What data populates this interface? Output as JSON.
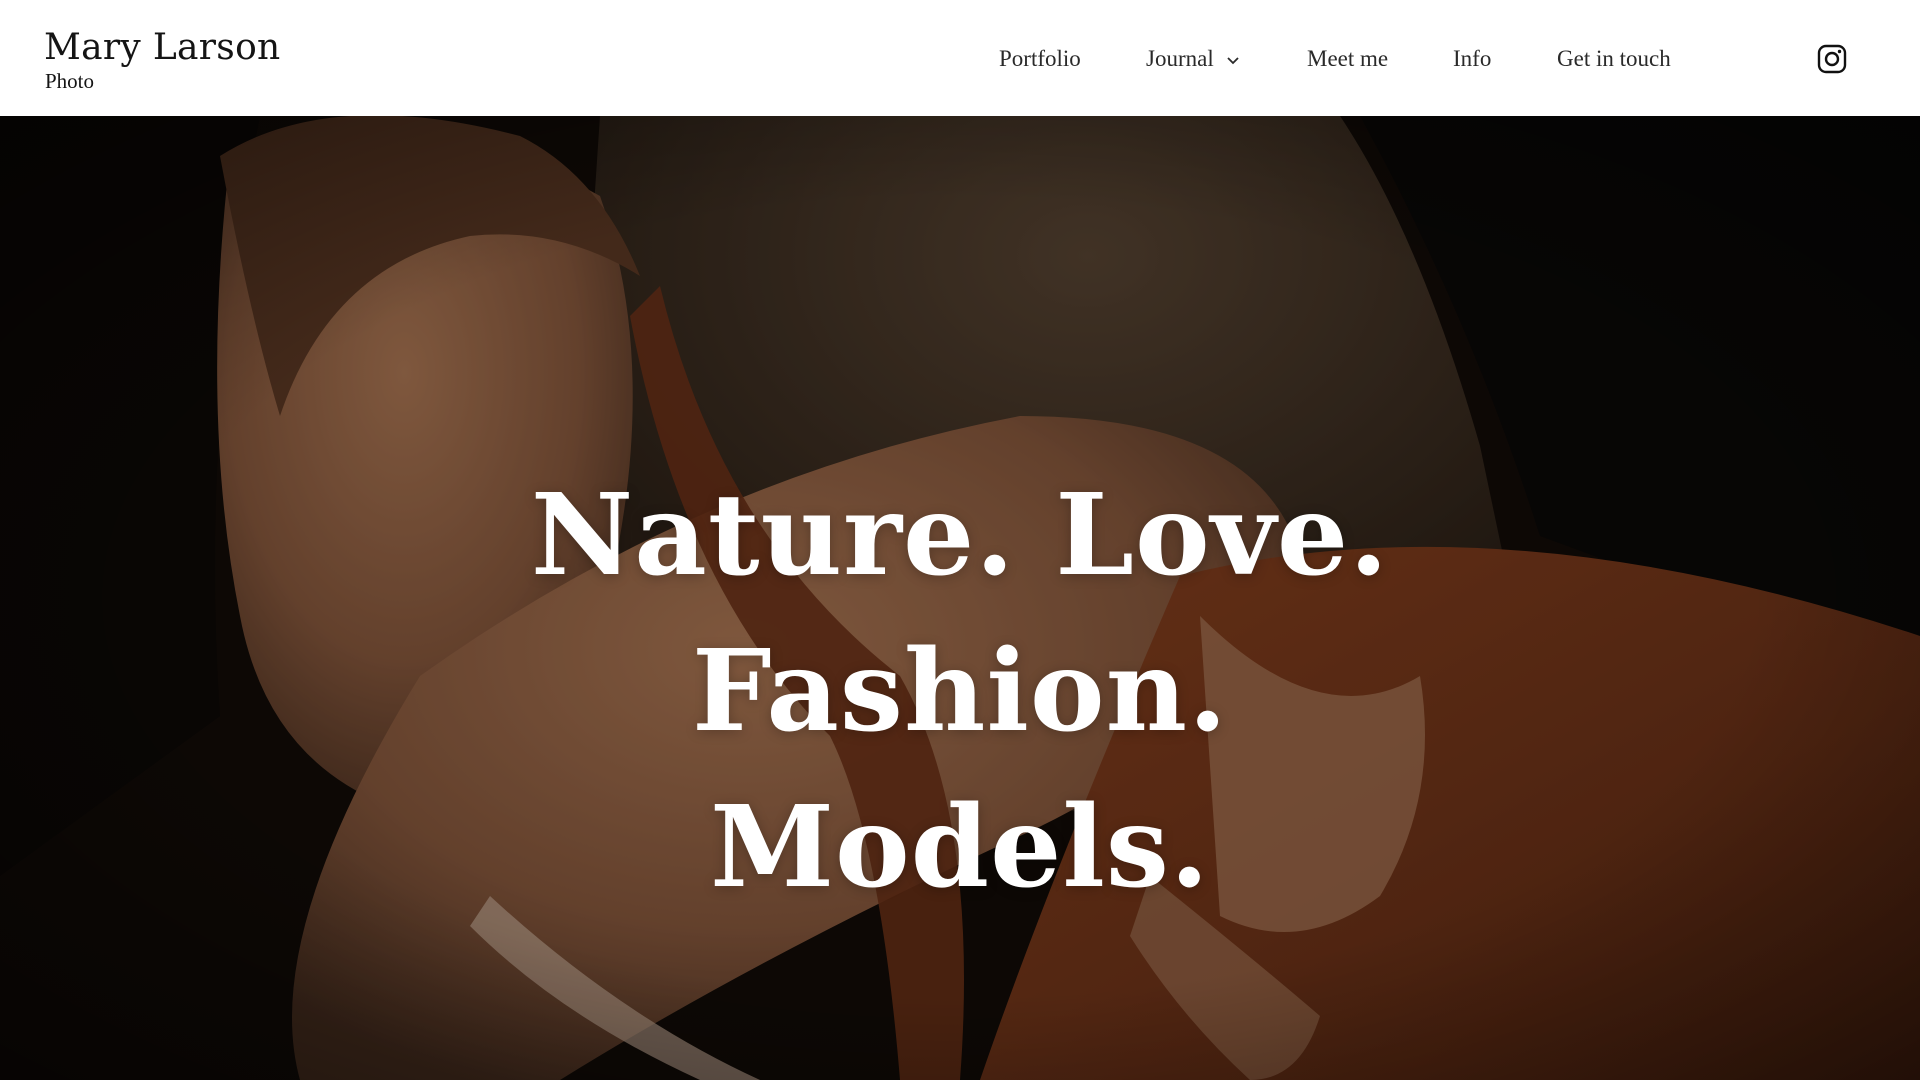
{
  "brand": {
    "title": "Mary Larson",
    "subtitle": "Photo"
  },
  "nav": {
    "items": [
      {
        "label": "Portfolio"
      },
      {
        "label": "Journal",
        "has_dropdown": true
      },
      {
        "label": "Meet me"
      },
      {
        "label": "Info"
      },
      {
        "label": "Get in touch"
      }
    ],
    "social_icon": "instagram-icon"
  },
  "hero": {
    "lines": [
      "Nature. Love.",
      "Fashion.",
      "Models."
    ],
    "background_description_colors": {
      "shadow": "#0e0b09",
      "rock": "#4a3a2c",
      "skin": "#9a6a4c",
      "fabric": "#7a3a1c"
    }
  }
}
